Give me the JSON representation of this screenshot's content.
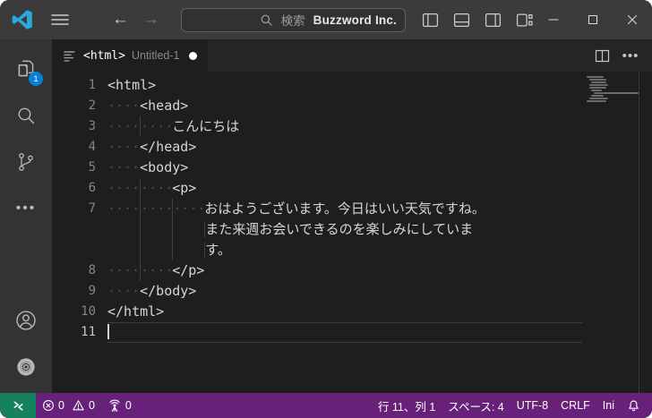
{
  "titlebar": {
    "search_placeholder": "検索",
    "window_title": "Buzzword Inc."
  },
  "tab": {
    "label": "<html>",
    "description": "Untitled-1"
  },
  "activity_bar": {
    "explorer_badge": "1"
  },
  "editor": {
    "lines": [
      {
        "num": "1",
        "indent": 0,
        "text": "<html>"
      },
      {
        "num": "2",
        "indent": 1,
        "text": "<head>"
      },
      {
        "num": "3",
        "indent": 2,
        "text": "こんにちは"
      },
      {
        "num": "4",
        "indent": 1,
        "text": "</head>"
      },
      {
        "num": "5",
        "indent": 1,
        "text": "<body>"
      },
      {
        "num": "6",
        "indent": 2,
        "text": "<p>"
      },
      {
        "num": "7",
        "indent": 3,
        "text": "おはようございます。今日はいい天気ですね。",
        "wrap": [
          "また来週お会いできるのを楽しみにしていま",
          "す。"
        ]
      },
      {
        "num": "8",
        "indent": 2,
        "text": "</p>"
      },
      {
        "num": "9",
        "indent": 1,
        "text": "</body>"
      },
      {
        "num": "10",
        "indent": 0,
        "text": "</html>"
      },
      {
        "num": "11",
        "indent": 0,
        "text": "",
        "active": true,
        "cursor": true
      }
    ]
  },
  "status_bar": {
    "errors": "0",
    "warnings": "0",
    "ports": "0",
    "cursor_position": "行 11、列 1",
    "indentation": "スペース: 4",
    "encoding": "UTF-8",
    "eol": "CRLF",
    "language": "Ini"
  },
  "colors": {
    "status_bar": "#68217A",
    "remote_indicator": "#16825D",
    "badge_blue": "#0a7fd6",
    "logo_blue": "#29a9e0"
  }
}
